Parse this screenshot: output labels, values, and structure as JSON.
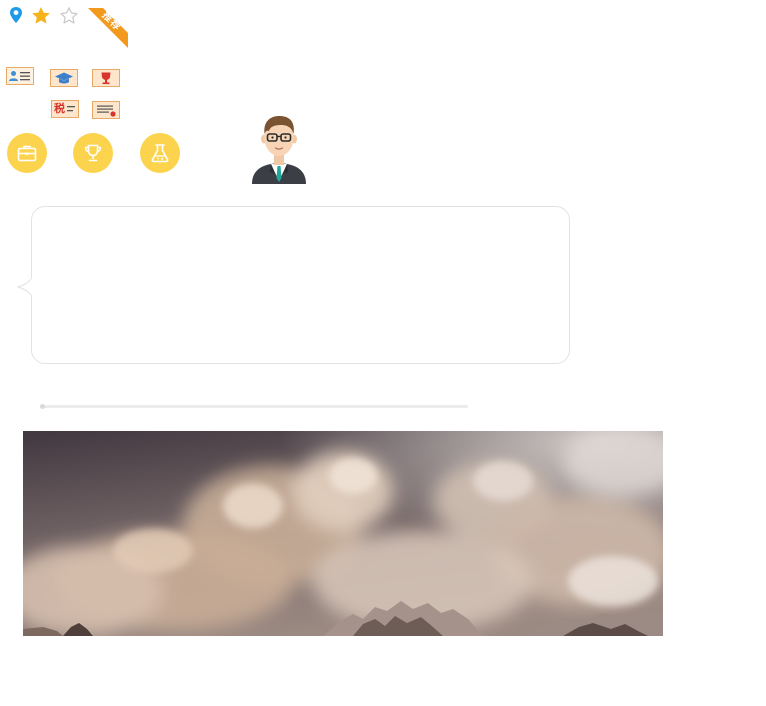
{
  "ribbon": {
    "label": "推荐",
    "color": "#f39a1e"
  },
  "certificates": {
    "tax_label": "税"
  },
  "colors": {
    "pin": "#1e9be8",
    "star": "#f5b21a",
    "star_outline": "#c8c8c8",
    "circle": "#fcd34d",
    "cert_fill": "#fde6cc",
    "cert_stroke": "#e8a866"
  },
  "icons": {
    "top_row": [
      "location-pin-icon",
      "star-filled-icon",
      "star-empty-icon"
    ],
    "circles": [
      "briefcase-icon",
      "trophy-icon",
      "flask-icon"
    ],
    "certs": [
      "id-card-icon",
      "graduation-cap-icon",
      "trophy-certificate-icon",
      "tax-certificate-icon",
      "seal-certificate-icon"
    ]
  },
  "progress": {
    "value": 0
  }
}
